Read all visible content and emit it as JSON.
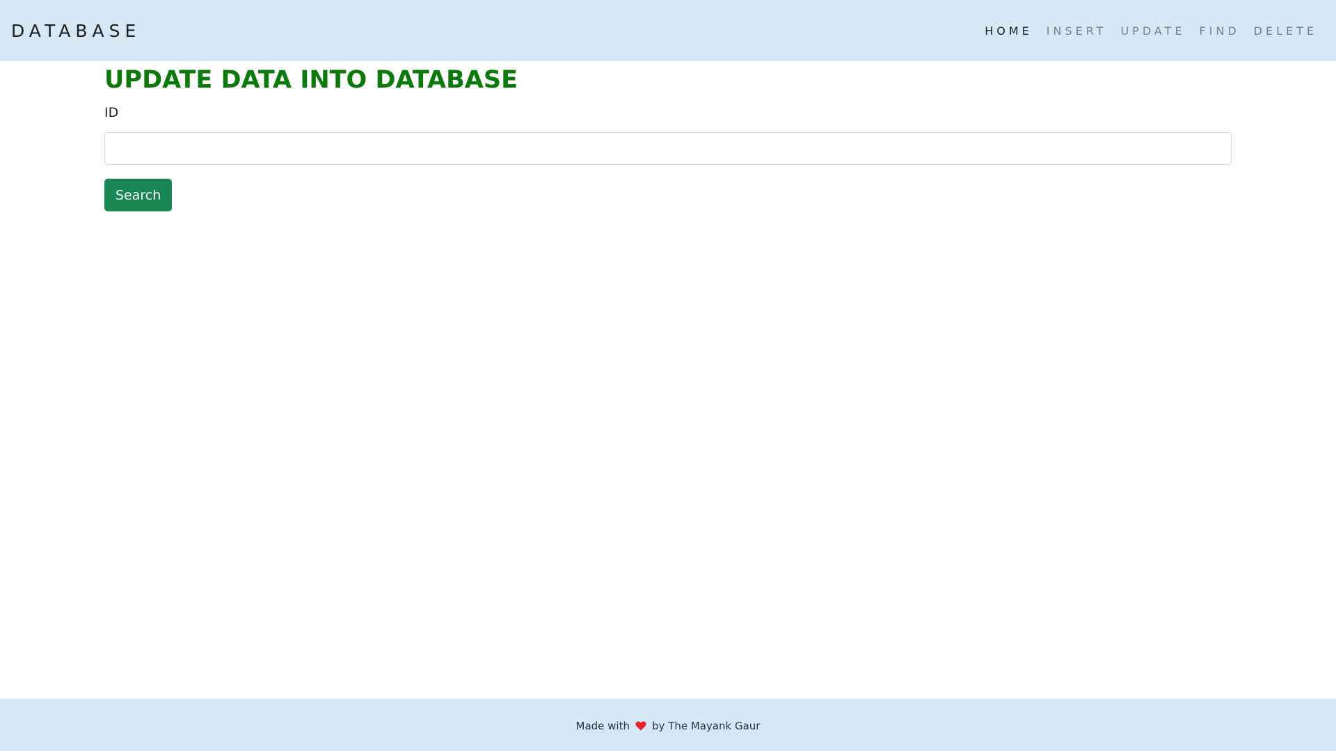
{
  "navbar": {
    "brand": "DATABASE",
    "links": [
      {
        "label": "HOME",
        "active": true
      },
      {
        "label": "INSERT",
        "active": false
      },
      {
        "label": "UPDATE",
        "active": false
      },
      {
        "label": "FIND",
        "active": false
      },
      {
        "label": "DELETE",
        "active": false
      }
    ]
  },
  "main": {
    "title": "UPDATE DATA INTO DATABASE",
    "id_label": "ID",
    "id_value": "",
    "id_placeholder": "",
    "search_label": "Search"
  },
  "footer": {
    "prefix": "Made with",
    "icon": "heart-icon",
    "suffix": "by The Mayank Gaur"
  },
  "colors": {
    "nav_background": "#d6e7f5",
    "title_color": "#0b7a0b",
    "button_color": "#198754",
    "heart_color": "#e8202a"
  }
}
